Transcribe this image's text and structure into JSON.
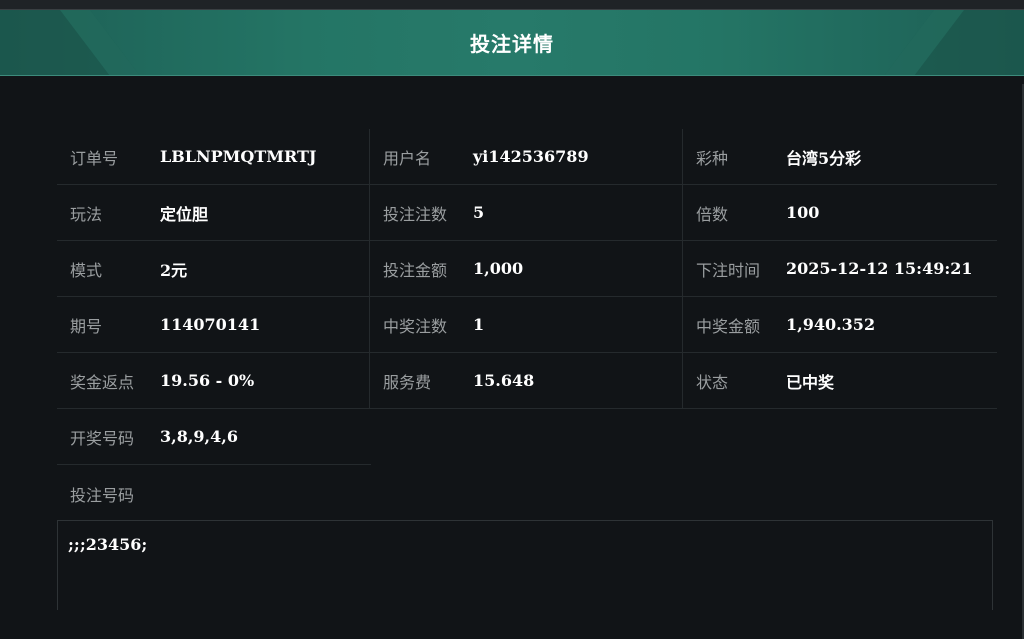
{
  "header": {
    "title": "投注详情"
  },
  "rows": [
    [
      {
        "label": "订单号",
        "value": "LBLNPMQTMRTJ"
      },
      {
        "label": "用户名",
        "value": "yi142536789"
      },
      {
        "label": "彩种",
        "value": "台湾5分彩"
      }
    ],
    [
      {
        "label": "玩法",
        "value": "定位胆"
      },
      {
        "label": "投注注数",
        "value": "5"
      },
      {
        "label": "倍数",
        "value": "100"
      }
    ],
    [
      {
        "label": "模式",
        "value": "2元"
      },
      {
        "label": "投注金额",
        "value": "1,000"
      },
      {
        "label": "下注时间",
        "value": "2025-12-12 15:49:21"
      }
    ],
    [
      {
        "label": "期号",
        "value": "114070141"
      },
      {
        "label": "中奖注数",
        "value": "1"
      },
      {
        "label": "中奖金额",
        "value": "1,940.352"
      }
    ],
    [
      {
        "label": "奖金返点",
        "value": "19.56 - 0%"
      },
      {
        "label": "服务费",
        "value": "15.648"
      },
      {
        "label": "状态",
        "value": "已中奖"
      }
    ],
    [
      {
        "label": "开奖号码",
        "value": "3,8,9,4,6"
      }
    ]
  ],
  "bet_numbers": {
    "label": "投注号码",
    "value": ";;;23456;"
  }
}
